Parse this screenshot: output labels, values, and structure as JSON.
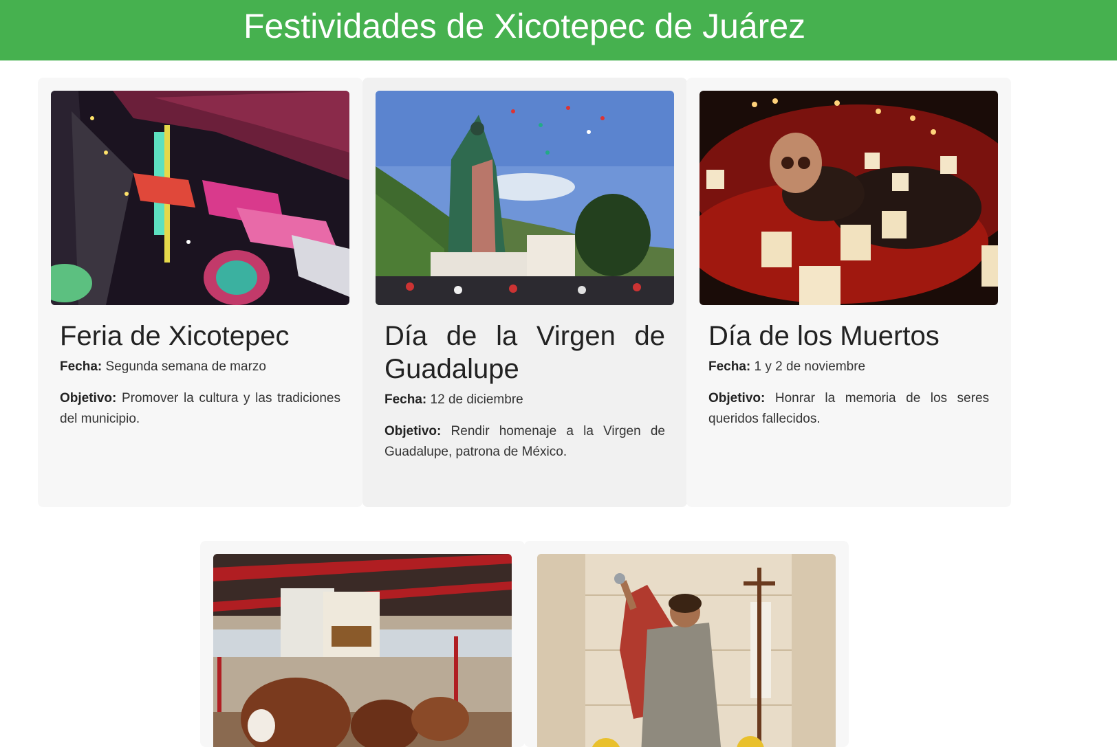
{
  "header": {
    "title": "Festividades de Xicotepec de Juárez",
    "bg_color": "#46b14f"
  },
  "cards": [
    {
      "title": "Feria de Xicotepec",
      "fecha_label": "Fecha:",
      "fecha": "Segunda semana de marzo",
      "objetivo_label": "Objetivo:",
      "objetivo": "Promover la cultura y las tradiciones del municipio.",
      "image": "fair-night-photo"
    },
    {
      "title": "Día de la Virgen de Guadalupe",
      "fecha_label": "Fecha:",
      "fecha": "12 de diciembre",
      "objetivo_label": "Objetivo:",
      "objetivo": "Rendir homenaje a la Virgen de Guadalupe, patrona de México.",
      "image": "virgin-statue-photo"
    },
    {
      "title": "Día de los Muertos",
      "fecha_label": "Fecha:",
      "fecha": "1 y 2 de noviembre",
      "objetivo_label": "Objetivo:",
      "objetivo": "Honrar la memoria de los seres queridos fallecidos.",
      "image": "candles-skull-photo"
    },
    {
      "image": "cattle-exhibition-photo"
    },
    {
      "image": "saint-statue-photo"
    }
  ]
}
